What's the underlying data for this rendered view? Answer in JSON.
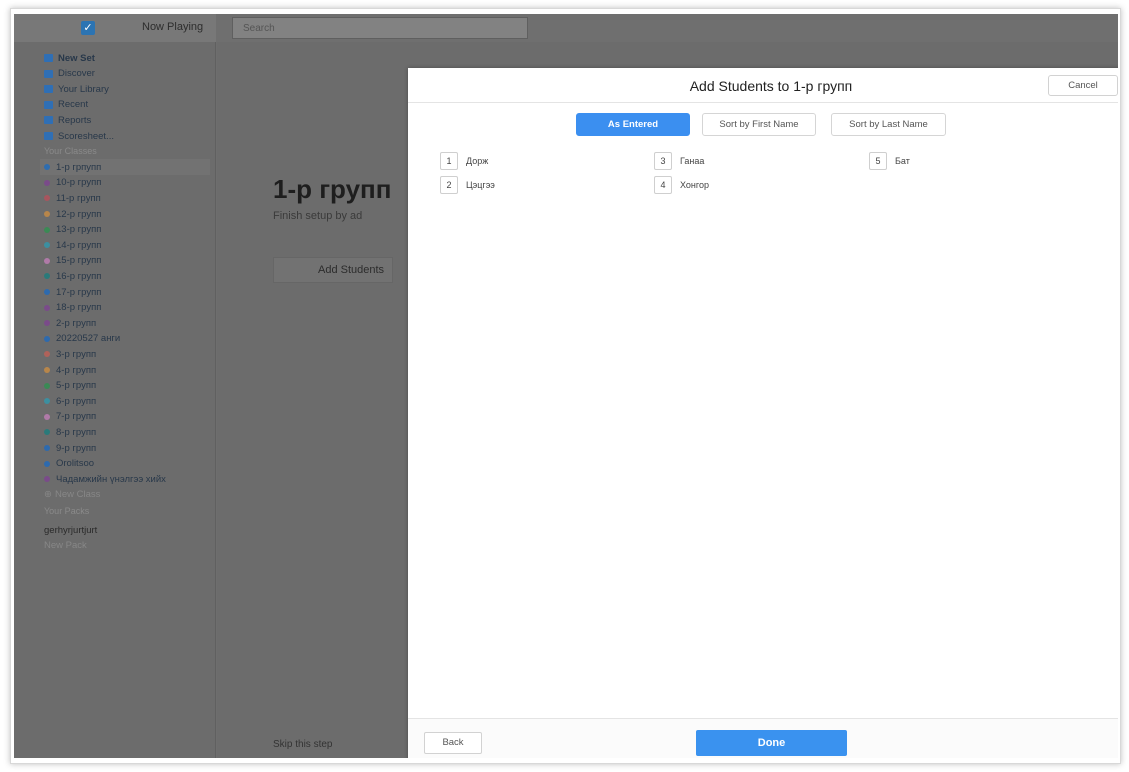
{
  "topbar": {
    "now_playing": "Now Playing",
    "search_placeholder": "Search"
  },
  "sidebar": {
    "top_items": [
      {
        "label": "New Set",
        "icon": "new-set-icon",
        "color": "#2f6fb5"
      },
      {
        "label": "Discover",
        "icon": "discover-icon",
        "color": "#2f6fb5"
      },
      {
        "label": "Your Library",
        "icon": "library-icon",
        "color": "#2f6fb5"
      },
      {
        "label": "Recent",
        "icon": "recent-icon",
        "color": "#2f6fb5"
      },
      {
        "label": "Reports",
        "icon": "reports-icon",
        "color": "#2f6fb5"
      },
      {
        "label": "Scoresheet...",
        "icon": "scoresheet-icon",
        "color": "#2f6fb5"
      }
    ],
    "classes_heading": "Your Classes",
    "classes": [
      {
        "label": "1-р грпупп",
        "color": "#2e6db0"
      },
      {
        "label": "10-р грyпп",
        "color": "#7a4b8a"
      },
      {
        "label": "11-р грyпп",
        "color": "#a8555e"
      },
      {
        "label": "12-р грyпп",
        "color": "#b8864a"
      },
      {
        "label": "13-р грyпп",
        "color": "#3b8a55"
      },
      {
        "label": "14-р грyпп",
        "color": "#3c8fa0"
      },
      {
        "label": "15-р грyпп",
        "color": "#b07aa8"
      },
      {
        "label": "16-р грyпп",
        "color": "#2a7a7a"
      },
      {
        "label": "17-р грyпп",
        "color": "#2d6aae"
      },
      {
        "label": "18-р грyпп",
        "color": "#7a4b8a"
      },
      {
        "label": "2-р грyпп",
        "color": "#7a4b8a"
      },
      {
        "label": "20220527 анги",
        "color": "#2d6aae"
      },
      {
        "label": "3-р грyпп",
        "color": "#b0625a"
      },
      {
        "label": "4-р грyпп",
        "color": "#b8864a"
      },
      {
        "label": "5-р грyпп",
        "color": "#3b8a55"
      },
      {
        "label": "6-р грyпп",
        "color": "#3c8fa0"
      },
      {
        "label": "7-р грyпп",
        "color": "#b07aa8"
      },
      {
        "label": "8-р грyпп",
        "color": "#2a7a7a"
      },
      {
        "label": "9-р грyпп",
        "color": "#2d6aae"
      },
      {
        "label": "Orolitsoo",
        "color": "#2d6aae"
      },
      {
        "label": "Чадамжийн үнэлгээ хийх",
        "color": "#7a4b8a"
      }
    ],
    "new_class": "New Class",
    "packs_heading": "Your Packs",
    "pack_item": "gerhyrjurtjurt",
    "new_pack": "New Pack"
  },
  "main": {
    "class_title": "1-р групп",
    "finish_text": "Finish setup by ad",
    "add_students": "Add Students",
    "skip": "Skip this step"
  },
  "modal": {
    "title": "Add Students to 1-р групп",
    "cancel": "Cancel",
    "sort_buttons": [
      "As Entered",
      "Sort by First Name",
      "Sort by Last Name"
    ],
    "students": [
      {
        "num": "1",
        "name": "Дорж"
      },
      {
        "num": "2",
        "name": "Цэцгээ"
      },
      {
        "num": "3",
        "name": "Ганаа"
      },
      {
        "num": "4",
        "name": "Хонгор"
      },
      {
        "num": "5",
        "name": "Бат"
      }
    ],
    "back": "Back",
    "done": "Done"
  },
  "colors": {
    "accent": "#3a92ef",
    "overlay": "#6c6c6c"
  }
}
